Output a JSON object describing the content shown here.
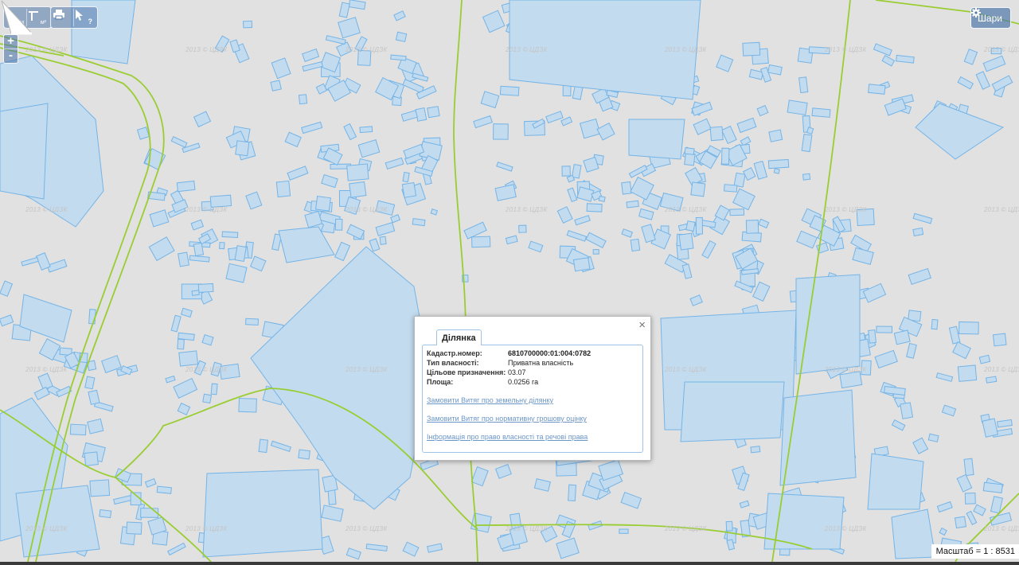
{
  "toolbar": {
    "measure_distance_sub": "м",
    "measure_area_sub": "м²",
    "print_icon": "printer-icon",
    "identify_sub": "?",
    "zoom_in": "+",
    "zoom_out": "-"
  },
  "layers_button": {
    "label": "Шари",
    "icon": "gear-icon"
  },
  "watermark": "2013 © ЦДЗК",
  "scale": {
    "label": "Масштаб = 1 : 8531"
  },
  "popup": {
    "tab_title": "Ділянка",
    "close": "×",
    "fields": [
      {
        "label": "Кадастр.номер:",
        "value": "6810700000:01:004:0782"
      },
      {
        "label": "Тип власності:",
        "value": "Приватна власність"
      },
      {
        "label": "Цільове призначення:",
        "value": "03.07"
      },
      {
        "label": "Площа:",
        "value": "0.0256 га"
      }
    ],
    "links": [
      "Замовити Витяг про земельну ділянку",
      "Замовити Витяг про нормативну грошову оцінку",
      "Інформація про право власності та речові права"
    ]
  },
  "colors": {
    "map_background": "#e1e1e1",
    "parcel_fill": "#c3dbef",
    "parcel_stroke": "#75b4e6",
    "road_line": "#9acd32",
    "control_bg": "#5078aa"
  }
}
